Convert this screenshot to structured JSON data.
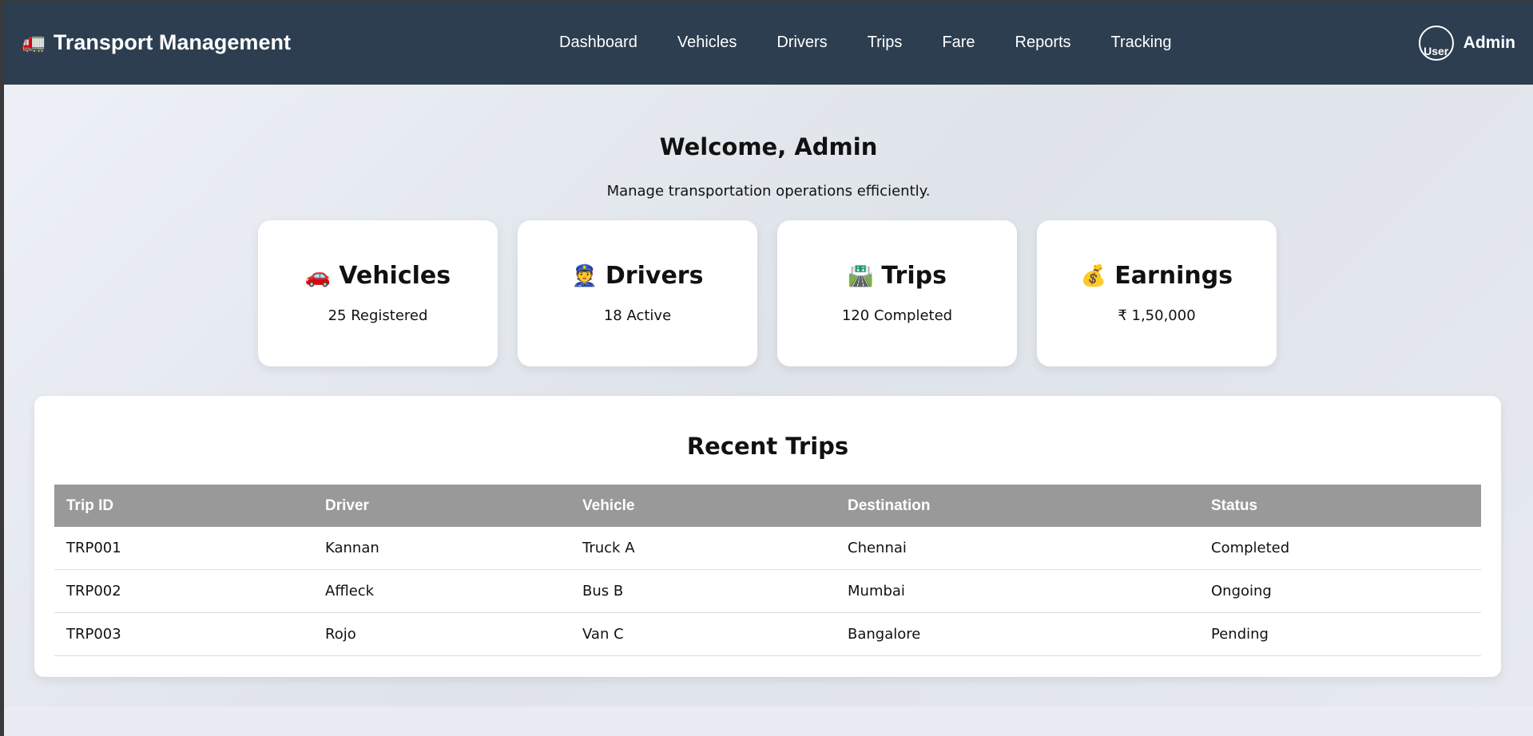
{
  "app": {
    "brand_icon": "🚛",
    "brand_name": "Transport Management"
  },
  "nav": {
    "items": [
      "Dashboard",
      "Vehicles",
      "Drivers",
      "Trips",
      "Fare",
      "Reports",
      "Tracking"
    ]
  },
  "user": {
    "avatar_alt": "User",
    "name": "Admin"
  },
  "hero": {
    "title": "Welcome, Admin",
    "subtitle": "Manage transportation operations efficiently."
  },
  "cards": [
    {
      "icon": "🚗",
      "title": "Vehicles",
      "value": "25 Registered"
    },
    {
      "icon": "👮",
      "title": "Drivers",
      "value": "18 Active"
    },
    {
      "icon": "🛣️",
      "title": "Trips",
      "value": "120 Completed"
    },
    {
      "icon": "💰",
      "title": "Earnings",
      "value": "₹ 1,50,000"
    }
  ],
  "recent_trips": {
    "title": "Recent Trips",
    "columns": [
      "Trip ID",
      "Driver",
      "Vehicle",
      "Destination",
      "Status"
    ],
    "rows": [
      [
        "TRP001",
        "Kannan",
        "Truck A",
        "Chennai",
        "Completed"
      ],
      [
        "TRP002",
        "Affleck",
        "Bus B",
        "Mumbai",
        "Ongoing"
      ],
      [
        "TRP003",
        "Rojo",
        "Van C",
        "Bangalore",
        "Pending"
      ]
    ]
  },
  "colors": {
    "navbar": "#2c3e50",
    "table_header": "#999999",
    "card_bg": "#ffffff"
  }
}
